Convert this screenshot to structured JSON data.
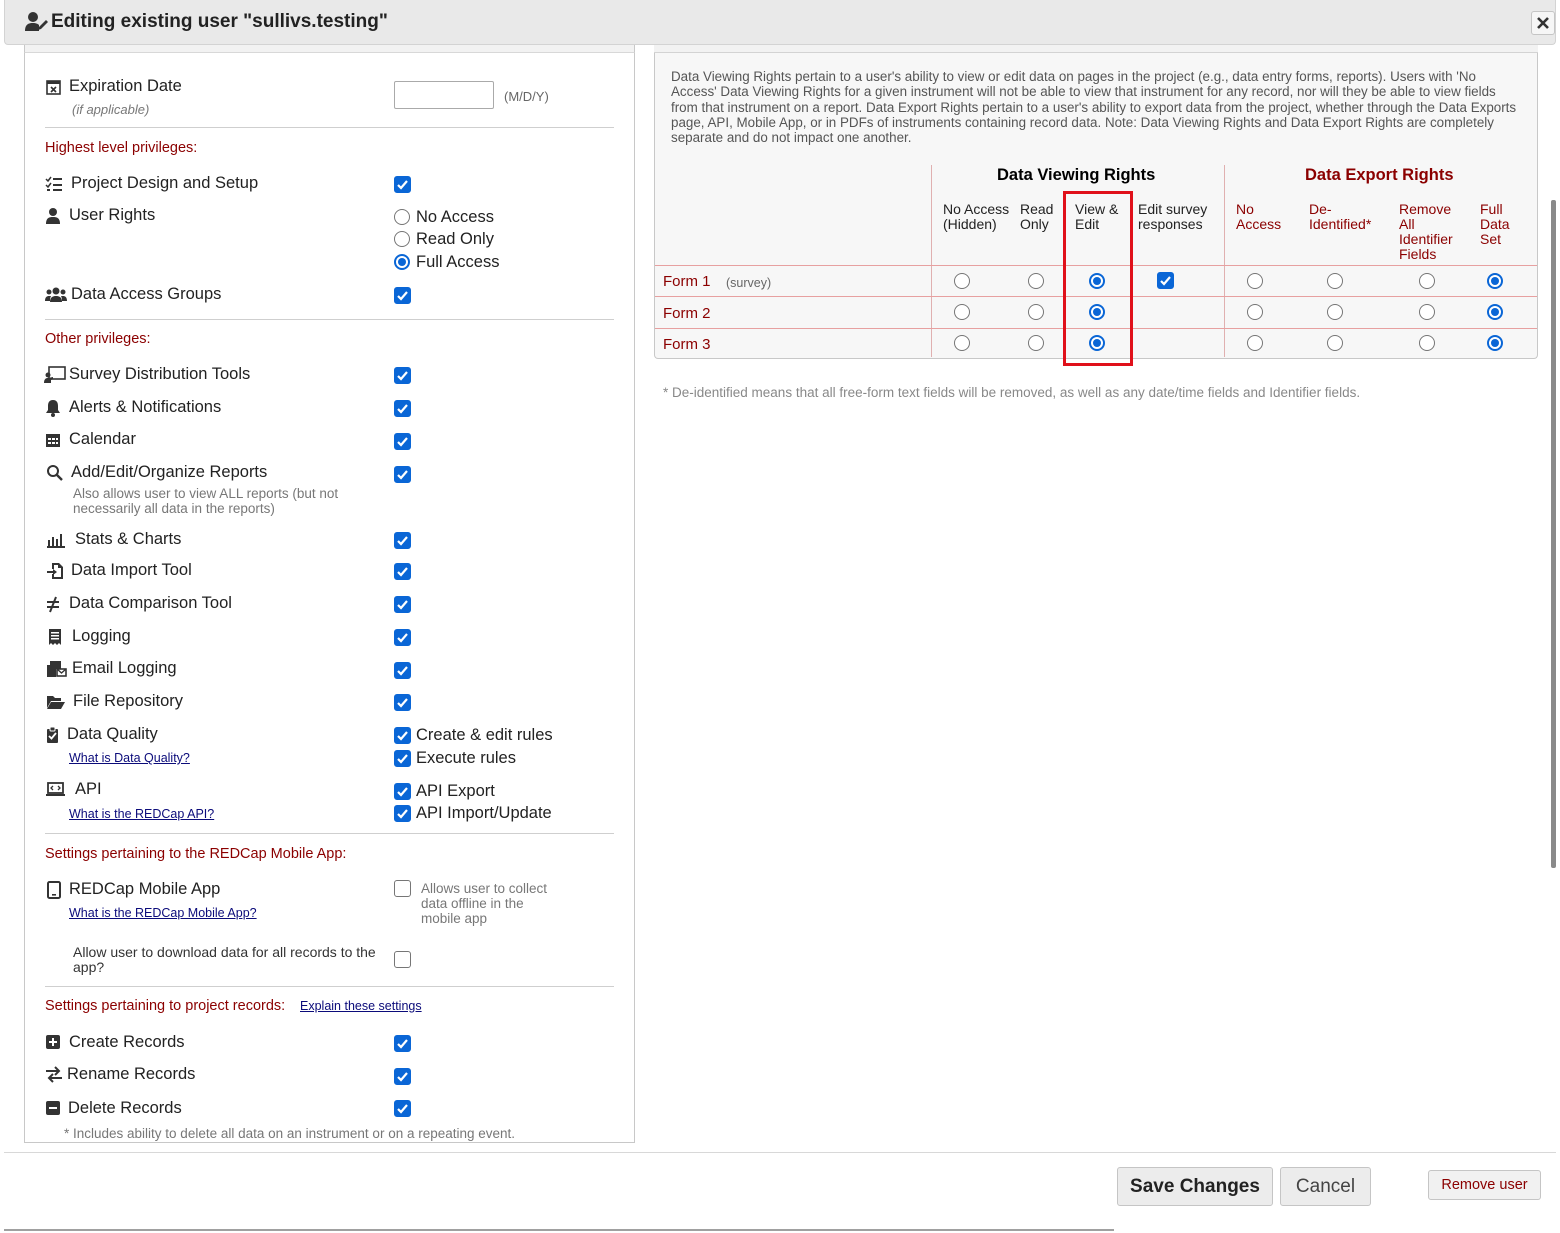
{
  "dialog": {
    "title": "Editing existing user \"sullivs.testing\""
  },
  "expiration": {
    "label": "Expiration Date",
    "sublabel": "(if applicable)",
    "value": "",
    "format_hint": "(M/D/Y)"
  },
  "highest": {
    "heading": "Highest level privileges:",
    "project_design": "Project Design and Setup",
    "user_rights": "User Rights",
    "user_rights_options": [
      "No Access",
      "Read Only",
      "Full Access"
    ],
    "user_rights_selected": "Full Access",
    "dag": "Data Access Groups"
  },
  "other": {
    "heading": "Other privileges:",
    "survey_tools": "Survey Distribution Tools",
    "alerts": "Alerts & Notifications",
    "calendar": "Calendar",
    "reports": "Add/Edit/Organize Reports",
    "reports_note": "Also allows user to view ALL reports (but not necessarily all data in the reports)",
    "stats": "Stats & Charts",
    "import": "Data Import Tool",
    "comparison": "Data Comparison Tool",
    "logging": "Logging",
    "email_logging": "Email Logging",
    "file_repo": "File Repository",
    "dq": "Data Quality",
    "dq_link": "What is Data Quality?",
    "dq_create": "Create & edit rules",
    "dq_execute": "Execute rules",
    "api": "API",
    "api_link": "What is the REDCap API?",
    "api_export": "API Export",
    "api_import": "API Import/Update"
  },
  "mobile": {
    "heading": "Settings pertaining to the REDCap Mobile App:",
    "app": "REDCap Mobile App",
    "app_link": "What is the REDCap Mobile App?",
    "app_note": "Allows user to collect data offline in the mobile app",
    "download": "Allow user to download data for all records to the app?"
  },
  "records": {
    "heading": "Settings pertaining to project records:",
    "explain_link": "Explain these settings",
    "create": "Create Records",
    "rename": "Rename Records",
    "delete": "Delete Records",
    "delete_note": "* Includes ability to delete all data on an instrument or on a repeating event."
  },
  "rights": {
    "info": "Data Viewing Rights pertain to a user's ability to view or edit data on pages in the project (e.g., data entry forms, reports). Users with 'No Access' Data Viewing Rights for a given instrument will not be able to view that instrument for any record, nor will they be able to view fields from that instrument on a report. Data Export Rights pertain to a user's ability to export data from the project, whether through the Data Exports page, API, Mobile App, or in PDFs of instruments containing record data. Note: Data Viewing Rights and Data Export Rights are completely separate and do not impact one another.",
    "viewing_heading": "Data Viewing Rights",
    "export_heading": "Data Export Rights",
    "viewing_cols": [
      "No Access (Hidden)",
      "Read Only",
      "View & Edit",
      "Edit survey responses"
    ],
    "export_cols": [
      "No Access",
      "De-Identified*",
      "Remove All Identifier Fields",
      "Full Data Set"
    ],
    "forms": [
      {
        "name": "Form 1",
        "tag": "(survey)",
        "viewing": "View & Edit",
        "edit_survey": true,
        "export": "Full Data Set"
      },
      {
        "name": "Form 2",
        "tag": "",
        "viewing": "View & Edit",
        "edit_survey": null,
        "export": "Full Data Set"
      },
      {
        "name": "Form 3",
        "tag": "",
        "viewing": "View & Edit",
        "edit_survey": null,
        "export": "Full Data Set"
      }
    ],
    "footnote": "* De-identified means that all free-form text fields will be removed, as well as any date/time fields and Identifier fields."
  },
  "buttons": {
    "save": "Save Changes",
    "cancel": "Cancel",
    "remove": "Remove user"
  },
  "colors": {
    "accent": "#0a66d6",
    "section_red": "#8b0000",
    "highlight": "#e0101a"
  },
  "icons": [
    "user-edit-icon",
    "close-icon",
    "calendar-x-icon",
    "list-check-icon",
    "user-icon",
    "users-icon",
    "chalkboard-icon",
    "bell-icon",
    "calendar-icon",
    "search-icon",
    "bar-chart-icon",
    "file-import-icon",
    "not-equal-icon",
    "receipt-icon",
    "mail-bulk-icon",
    "folder-open-icon",
    "clipboard-check-icon",
    "laptop-code-icon",
    "tablet-icon",
    "plus-square-icon",
    "exchange-icon",
    "minus-square-icon"
  ]
}
